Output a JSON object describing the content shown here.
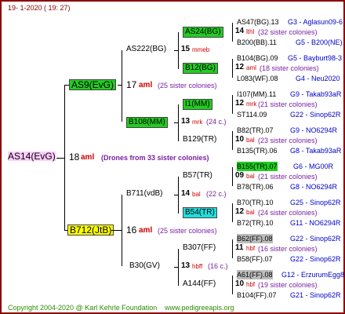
{
  "header": {
    "date": "19-  1-2020 ( 19: 27)"
  },
  "footer": {
    "copyright": "Copyright 2004-2020 @ Karl Kehrle Foundation",
    "url": "www.pedigreeapis.org"
  },
  "root": {
    "code": "AS14(EvG)",
    "gen": "18",
    "suffix": "aml",
    "note": "(Drones from 33 sister colonies)"
  },
  "g17": [
    {
      "code": "AS9(EvG)",
      "gen": "17",
      "suffix": "aml",
      "note": "(25 sister colonies)"
    },
    {
      "code": "B712(JtB)",
      "gen": "16",
      "suffix": "aml",
      "note": "(25 sister colonies)"
    }
  ],
  "g16": [
    {
      "code": "AS222(BG)",
      "gen": "15",
      "suffix": "mmeb"
    },
    {
      "code": "B108(MM)",
      "gen": "13",
      "suffix": "mrk",
      "note": "(24 c.)"
    },
    {
      "code": "B711(vdB)",
      "gen": "14",
      "suffix": "bal",
      "note": "(22 c.)"
    },
    {
      "code": "B30(GV)",
      "gen": "13",
      "suffix": "hbff",
      "note": "(16 c.)"
    }
  ],
  "g15": [
    {
      "code": "AS24(BG)",
      "gen": "14",
      "suffix": "lthl",
      "note": "(32 sister colonies)"
    },
    {
      "code": "B12(BG)",
      "gen": "12",
      "suffix": "aml",
      "note": "(18 sister colonies)"
    },
    {
      "code": "I1(MM)",
      "gen": "12",
      "suffix": "mrk",
      "note": "(21 sister colonies)"
    },
    {
      "code": "B129(TR)",
      "gen": "10",
      "suffix": "bal",
      "note": "(23 sister colonies)"
    },
    {
      "code": "B57(TR)",
      "gen": "09",
      "suffix": "bal",
      "note": "(21 sister colonies)"
    },
    {
      "code": "B54(TR)",
      "gen": "12",
      "suffix": "bal",
      "note": "(24 sister colonies)"
    },
    {
      "code": "B307(FF)",
      "gen": "11",
      "suffix": "hbf",
      "note": "(16 sister colonies)"
    },
    {
      "code": "A144(FF)",
      "gen": "10",
      "suffix": "hbf",
      "note": "(19 sister colonies)"
    }
  ],
  "g14": [
    {
      "left": "AS47(BG).13",
      "right": "G3 - Aglasun09-6"
    },
    {
      "left": "B200(BB).11",
      "right": "G5 - B200(NE)"
    },
    {
      "left": "B104(BG).09",
      "right": "G5 - Bayburt98-3"
    },
    {
      "left": "L083(WF).08",
      "right": "G4 - Neu2020"
    },
    {
      "left": "I107(MM).11",
      "right": "G9 - Takab93aR"
    },
    {
      "left": "ST114.09",
      "right": "G22 - Sinop62R"
    },
    {
      "left": "B82(TR).07",
      "right": "G9 - NO6294R"
    },
    {
      "left": "B135(TR).06",
      "right": "G8 - Takab93aR"
    },
    {
      "left": "B155(TR).07",
      "right": "G6 - MG00R"
    },
    {
      "left": "B78(TR).06",
      "right": "G8 - NO6294R"
    },
    {
      "left": "B70(TR).10",
      "right": "G25 - Sinop62R"
    },
    {
      "left": "B72(TR).10",
      "right": "G11 - NO6294R"
    },
    {
      "left": "B62(FF).08",
      "right": "G22 - Sinop62R"
    },
    {
      "left": "B58(FF).07",
      "right": "G22 - Sinop62R"
    },
    {
      "left": "A61(FF).08",
      "right": "G12 - ErzurumEgg8"
    },
    {
      "left": "B104(FF).07",
      "right": "G21 - Sinop62R"
    }
  ]
}
